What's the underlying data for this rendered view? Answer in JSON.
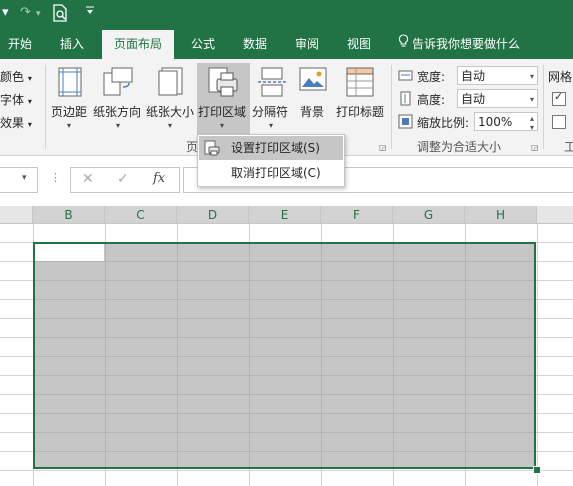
{
  "tabs": [
    {
      "label": "开始"
    },
    {
      "label": "插入"
    },
    {
      "label": "页面布局"
    },
    {
      "label": "公式"
    },
    {
      "label": "数据"
    },
    {
      "label": "审阅"
    },
    {
      "label": "视图"
    }
  ],
  "tell_me": "告诉我你想要做什么",
  "ribbon": {
    "theme_colors": "颜色",
    "theme_fonts": "字体",
    "theme_effects": "效果",
    "margins": "页边距",
    "orientation": "纸张方向",
    "size": "纸张大小",
    "print_area": "打印区域",
    "breaks": "分隔符",
    "background": "背景",
    "print_titles": "打印标题",
    "group_page_setup": "页",
    "width_label": "宽度:",
    "width_value": "自动",
    "height_label": "高度:",
    "height_value": "自动",
    "scale_label": "缩放比例:",
    "scale_value": "100%",
    "group_scale": "调整为合适大小",
    "sheet_options": "网格",
    "group_tool": "工"
  },
  "formula_bar": {
    "fx": "fx"
  },
  "columns": [
    "B",
    "C",
    "D",
    "E",
    "F",
    "G",
    "H"
  ],
  "menu": {
    "set_print_area": "设置打印区域(S)",
    "clear_print_area": "取消打印区域(C)"
  },
  "colors": {
    "excel_green": "#217346",
    "selection_gray": "#c6c6c6"
  }
}
